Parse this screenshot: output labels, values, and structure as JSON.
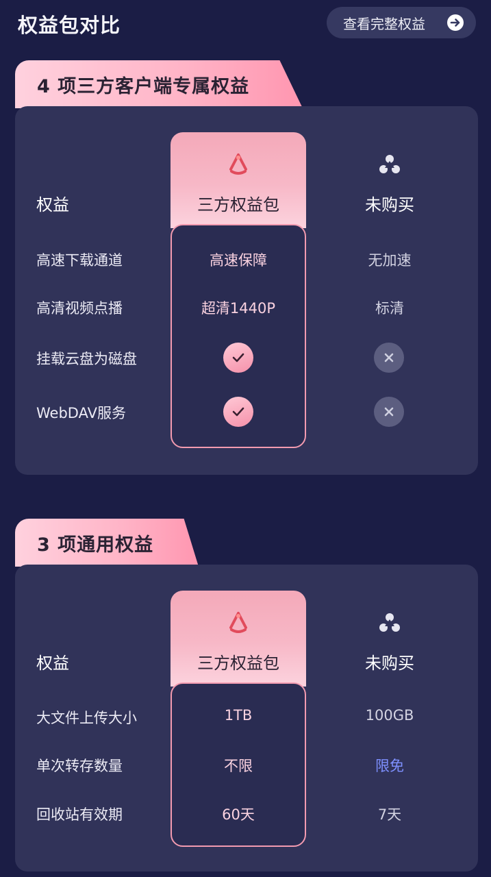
{
  "header": {
    "title": "权益包对比",
    "view_all_label": "查看完整权益"
  },
  "sections": [
    {
      "tab_label": "4 项三方客户端专属权益",
      "col_label": "权益",
      "col_a": "三方权益包",
      "col_b": "未购买",
      "rows": [
        {
          "label": "高速下载通道",
          "a": "高速保障",
          "b": "无加速"
        },
        {
          "label": "高清视频点播",
          "a": "超清1440P",
          "b": "标清"
        },
        {
          "label": "挂载云盘为磁盘",
          "a": "check",
          "b": "cross"
        },
        {
          "label": "WebDAV服务",
          "a": "check",
          "b": "cross"
        }
      ]
    },
    {
      "tab_label": "3 项通用权益",
      "col_label": "权益",
      "col_a": "三方权益包",
      "col_b": "未购买",
      "rows": [
        {
          "label": "大文件上传大小",
          "a": "1TB",
          "b": "100GB"
        },
        {
          "label": "单次转存数量",
          "a": "不限",
          "b": "限免"
        },
        {
          "label": "回收站有效期",
          "a": "60天",
          "b": "7天"
        }
      ]
    }
  ],
  "icons": {
    "arrow": "arrow-right-circle-icon",
    "package_logo": "three-party-package-logo-icon",
    "unpurchased_logo": "unpurchased-logo-icon",
    "check": "check-icon",
    "cross": "close-icon"
  },
  "colors": {
    "background": "#1b1d45",
    "card": "#313359",
    "accent_pink": "#f7a6bb",
    "highlight_blue": "#7e90ff"
  }
}
